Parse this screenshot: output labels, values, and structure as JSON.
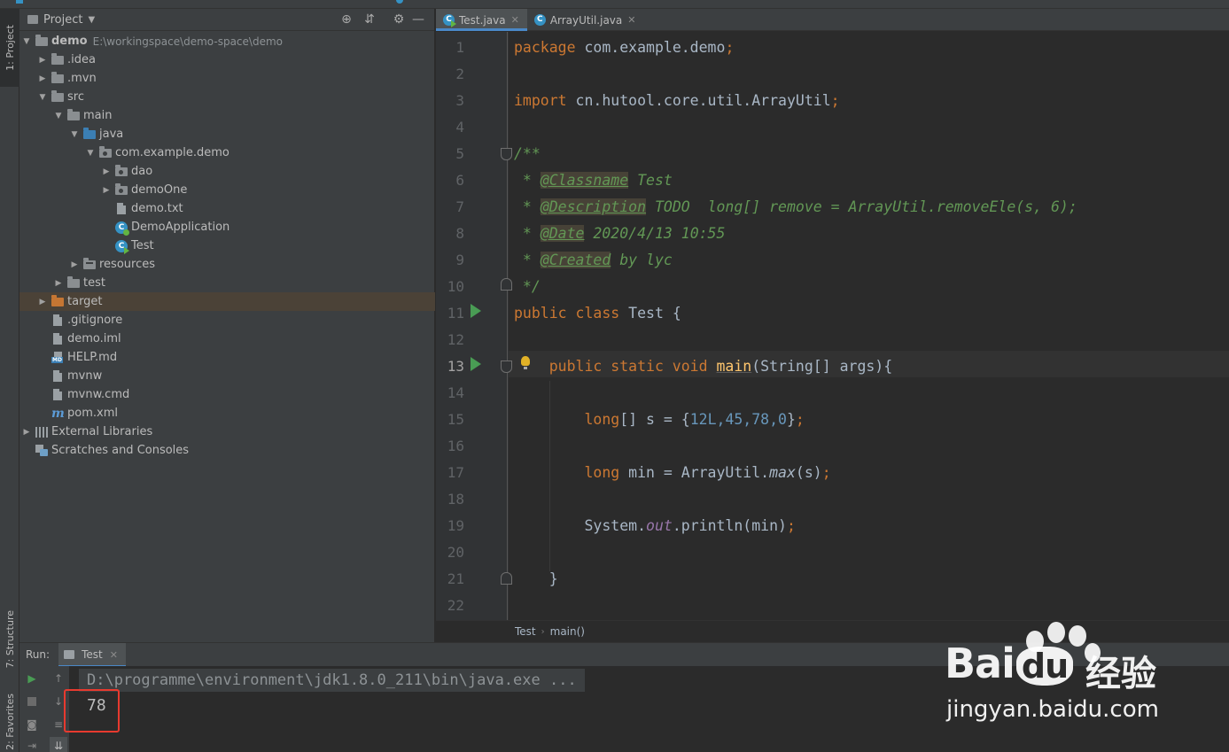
{
  "side_tabs": {
    "project": "1: Project",
    "structure": "7: Structure",
    "favorites": "2: Favorites"
  },
  "project_panel": {
    "title": "Project",
    "tree": [
      {
        "label": "demo",
        "path": "E:\\workingspace\\demo-space\\demo",
        "icon": "module-folder-icon",
        "expanded": true
      },
      {
        "label": ".idea",
        "icon": "folder-icon",
        "expanded": false
      },
      {
        "label": ".mvn",
        "icon": "folder-icon",
        "expanded": false
      },
      {
        "label": "src",
        "icon": "folder-icon",
        "expanded": true
      },
      {
        "label": "main",
        "icon": "folder-icon",
        "expanded": true
      },
      {
        "label": "java",
        "icon": "source-folder-icon",
        "expanded": true
      },
      {
        "label": "com.example.demo",
        "icon": "package-icon",
        "expanded": true
      },
      {
        "label": "dao",
        "icon": "package-icon",
        "expanded": false
      },
      {
        "label": "demoOne",
        "icon": "package-icon",
        "expanded": false
      },
      {
        "label": "demo.txt",
        "icon": "text-file-icon"
      },
      {
        "label": "DemoApplication",
        "icon": "spring-class-icon"
      },
      {
        "label": "Test",
        "icon": "runnable-class-icon"
      },
      {
        "label": "resources",
        "icon": "resources-folder-icon",
        "expanded": false
      },
      {
        "label": "test",
        "icon": "folder-icon",
        "expanded": false
      },
      {
        "label": "target",
        "icon": "excluded-folder-icon",
        "expanded": false,
        "selected": true
      },
      {
        "label": ".gitignore",
        "icon": "text-file-icon"
      },
      {
        "label": "demo.iml",
        "icon": "iml-file-icon"
      },
      {
        "label": "HELP.md",
        "icon": "markdown-file-icon"
      },
      {
        "label": "mvnw",
        "icon": "text-file-icon"
      },
      {
        "label": "mvnw.cmd",
        "icon": "text-file-icon"
      },
      {
        "label": "pom.xml",
        "icon": "maven-file-icon"
      },
      {
        "label": "External Libraries",
        "icon": "libraries-icon",
        "expanded": false
      },
      {
        "label": "Scratches and Consoles",
        "icon": "scratches-icon"
      }
    ]
  },
  "editor": {
    "tabs": [
      {
        "label": "Test.java",
        "active": true
      },
      {
        "label": "ArrayUtil.java",
        "active": false
      }
    ],
    "line_numbers": [
      "1",
      "2",
      "3",
      "4",
      "5",
      "6",
      "7",
      "8",
      "9",
      "10",
      "11",
      "12",
      "13",
      "14",
      "15",
      "16",
      "17",
      "18",
      "19",
      "20",
      "21",
      "22"
    ],
    "current_line": "13",
    "code": {
      "l1_kw": "package",
      "l1_rest": " com.example.demo",
      "l1_semi": ";",
      "l3_kw": "import",
      "l3_rest": " cn.hutool.core.util.ArrayUtil",
      "l3_semi": ";",
      "l5": "/**",
      "l6_star": " * ",
      "l6_tag": "@Classname",
      "l6_val": " Test",
      "l7_star": " * ",
      "l7_tag": "@Description",
      "l7_val": " TODO  long[] remove = ArrayUtil.removeEle(s, 6);",
      "l8_star": " * ",
      "l8_tag": "@Date",
      "l8_val": " 2020/4/13 10:55",
      "l9_star": " * ",
      "l9_tag": "@Created",
      "l9_val": " by lyc",
      "l10": " */",
      "l11_kw": "public class",
      "l11_rest": " Test {",
      "l13_kw": "    public static void",
      "l13_fn": "main",
      "l13_rest": "(String[] args){",
      "l15_a": "        long",
      "l15_b": "[] s = {",
      "l15_nums": "12L,45,78,0",
      "l15_c": "}",
      "l15_semi": ";",
      "l17_a": "        long",
      "l17_b": " min = ArrayUtil.",
      "l17_fn": "max",
      "l17_c": "(s)",
      "l17_semi": ";",
      "l19_a": "        System.",
      "l19_field": "out",
      "l19_b": ".println(min)",
      "l19_semi": ";",
      "l21": "    }"
    },
    "breadcrumb": [
      "Test",
      "main()"
    ]
  },
  "run_panel": {
    "title": "Run:",
    "tab": "Test",
    "command": "D:\\programme\\environment\\jdk1.8.0_211\\bin\\java.exe ...",
    "output": "78"
  },
  "watermark": {
    "brand_a": "Bai",
    "brand_du": "du",
    "brand_cn": "经验",
    "url": "jingyan.baidu.com"
  },
  "colors": {
    "keyword": "#cc7832",
    "number": "#6897bb",
    "function": "#ffc66d",
    "doc_comment": "#629755",
    "static_field": "#9876aa",
    "highlight_box": "#e83a2f"
  }
}
